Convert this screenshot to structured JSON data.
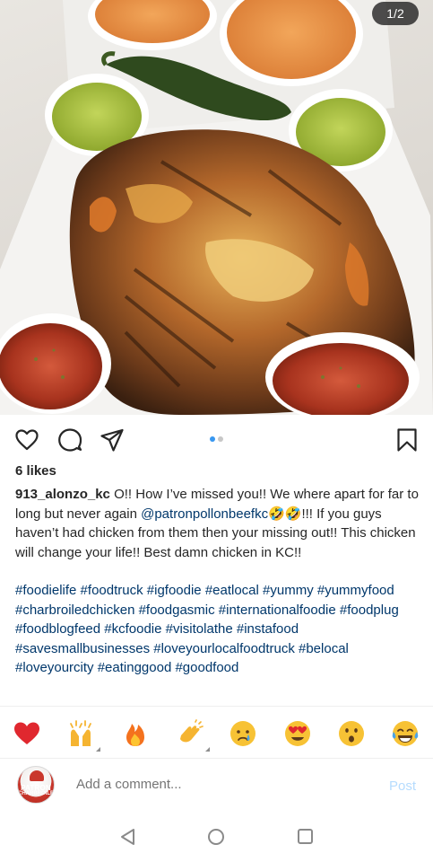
{
  "post": {
    "image_counter": "1/2",
    "likes": "6 likes",
    "username": "913_alonzo_kc",
    "caption_part1": " O!! How I’ve missed you!! We where apart for far to long but never again ",
    "mention": "@patronpollonbeefkc",
    "emoji_pair": "🤣🤣",
    "caption_part2": "!!! If you guys haven’t had chicken from them then your missing out!! This chicken will change your life!! Best damn chicken in KC!!",
    "hashtags": "#foodielife #foodtruck #igfoodie #eatlocal #yummy #yummyfood #charbroiledchicken #foodgasmic #internationalfoodie #foodplug #foodblogfeed #kcfoodie #visitolathe #instafood #savesmallbusinesses #loveyourlocalfoodtruck #belocal #loveyourcity #eatinggood #goodfood"
  },
  "carousel": {
    "active_color": "#3897f0",
    "inactive_color": "#c7c7c7",
    "count": 2,
    "active_index": 0
  },
  "actions": {
    "like_icon": "heart-outline-icon",
    "comment_icon": "comment-bubble-icon",
    "share_icon": "paper-plane-icon",
    "save_icon": "bookmark-icon"
  },
  "reactions": [
    {
      "name": "red-heart",
      "emoji": "❤️"
    },
    {
      "name": "raising-hands",
      "emoji": "🙌"
    },
    {
      "name": "fire",
      "emoji": "🔥"
    },
    {
      "name": "clapping-hands",
      "emoji": "👏"
    },
    {
      "name": "crying-face",
      "emoji": "😢"
    },
    {
      "name": "heart-eyes",
      "emoji": "😍"
    },
    {
      "name": "astonished-face",
      "emoji": "😮"
    },
    {
      "name": "tears-of-joy",
      "emoji": "😂"
    }
  ],
  "comment": {
    "placeholder": "Add a comment...",
    "post_label": "Post",
    "avatar_text_1": "PATRON",
    "avatar_text_2": "CHARBROILED"
  },
  "colors": {
    "link": "#00376b",
    "post_disabled": "#b6dcfe",
    "text": "#262626",
    "muted": "#a8a8a8"
  }
}
